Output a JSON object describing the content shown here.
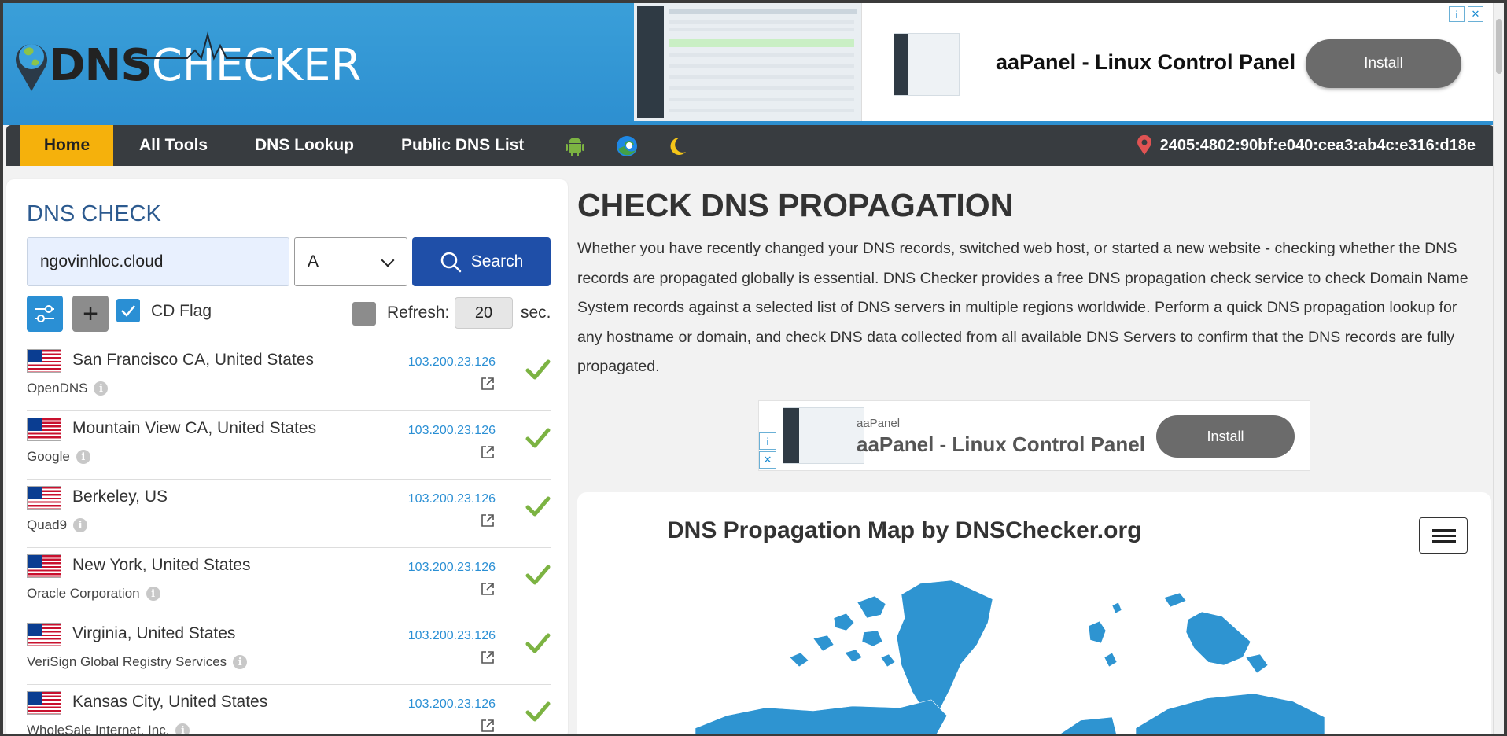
{
  "header": {
    "logo": {
      "dns": "DNS",
      "checker": "CHECKER"
    },
    "top_ad": {
      "title": "aaPanel - Linux Control Panel",
      "button": "Install",
      "info_icon": "i",
      "close_icon": "✕"
    }
  },
  "nav": {
    "items": [
      "Home",
      "All Tools",
      "DNS Lookup",
      "Public DNS List"
    ],
    "icons": [
      "android-icon",
      "edge-icon",
      "moon-icon"
    ],
    "ip_address": "2405:4802:90bf:e040:cea3:ab4c:e316:d18e"
  },
  "dns_check": {
    "title": "DNS CHECK",
    "domain_value": "ngovinhloc.cloud",
    "record_type": "A",
    "search_label": "Search",
    "plus_label": "+",
    "cd_flag_label": "CD Flag",
    "refresh_label": "Refresh:",
    "refresh_value": "20",
    "refresh_unit": "sec.",
    "results": [
      {
        "location": "San Francisco CA, United States",
        "provider": "OpenDNS",
        "ip": "103.200.23.126"
      },
      {
        "location": "Mountain View CA, United States",
        "provider": "Google",
        "ip": "103.200.23.126"
      },
      {
        "location": "Berkeley, US",
        "provider": "Quad9",
        "ip": "103.200.23.126"
      },
      {
        "location": "New York, United States",
        "provider": "Oracle Corporation",
        "ip": "103.200.23.126"
      },
      {
        "location": "Virginia, United States",
        "provider": "VeriSign Global Registry Services",
        "ip": "103.200.23.126"
      },
      {
        "location": "Kansas City, United States",
        "provider": "WholeSale Internet, Inc.",
        "ip": "103.200.23.126"
      }
    ]
  },
  "main": {
    "title": "CHECK DNS PROPAGATION",
    "description": "Whether you have recently changed your DNS records, switched web host, or started a new website - checking whether the DNS records are propagated globally is essential. DNS Checker provides a free DNS propagation check service to check Domain Name System records against a selected list of DNS servers in multiple regions worldwide. Perform a quick DNS propagation lookup for any hostname or domain, and check DNS data collected from all available DNS Servers to confirm that the DNS records are fully propagated.",
    "mid_ad": {
      "small": "aaPanel",
      "title": "aaPanel - Linux Control Panel",
      "button": "Install",
      "info_icon": "i",
      "close_icon": "✕"
    },
    "map_title": "DNS Propagation Map by DNSChecker.org"
  },
  "colors": {
    "header_blue": "#2d8fd0",
    "nav_dark": "#383c40",
    "home_yellow": "#f5b10c",
    "search_blue": "#1f4fa8",
    "map_blue": "#2e94d1",
    "check_green": "#7cb342"
  }
}
